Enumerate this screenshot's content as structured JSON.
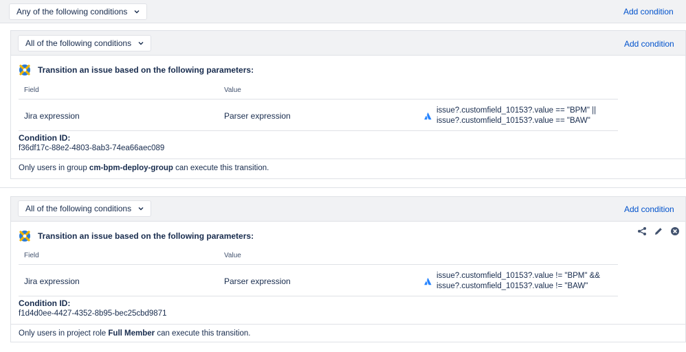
{
  "outer": {
    "operator": "Any of the following conditions",
    "add_condition": "Add condition"
  },
  "groups": [
    {
      "operator": "All of the following conditions",
      "add_condition": "Add condition",
      "condition": {
        "icon": "jmwe-condition-icon",
        "title": "Transition an issue based on the following parameters:",
        "table": {
          "headers": [
            "Field",
            "Value"
          ],
          "row": {
            "field": "Jira expression",
            "type": "Parser expression",
            "expression_line1": "issue?.customfield_10153?.value == \"BPM\" ||",
            "expression_line2": "issue?.customfield_10153?.value == \"BAW\""
          }
        },
        "id_label": "Condition ID:",
        "id_value": "f36df17c-88e2-4803-8ab3-74ea66aec089"
      },
      "footer": {
        "prefix": "Only users in group ",
        "bold": "cm-bpm-deploy-group",
        "suffix": " can execute this transition."
      }
    },
    {
      "operator": "All of the following conditions",
      "add_condition": "Add condition",
      "condition": {
        "icon": "jmwe-condition-icon",
        "title": "Transition an issue based on the following parameters:",
        "table": {
          "headers": [
            "Field",
            "Value"
          ],
          "row": {
            "field": "Jira expression",
            "type": "Parser expression",
            "expression_line1": "issue?.customfield_10153?.value != \"BPM\" &&",
            "expression_line2": "issue?.customfield_10153?.value != \"BAW\""
          }
        },
        "id_label": "Condition ID:",
        "id_value": "f1d4d0ee-4427-4352-8b95-bec25cbd9871",
        "actions": [
          "share-icon",
          "edit-pencil-icon",
          "delete-icon"
        ]
      },
      "footer": {
        "prefix": "Only users in project role ",
        "bold": "Full Member",
        "suffix": " can execute this transition."
      }
    }
  ],
  "colors": {
    "link": "#0052cc",
    "bar_bg": "#f1f2f4",
    "border": "#dfe1e6",
    "atlassian_blue": "#2684ff"
  }
}
